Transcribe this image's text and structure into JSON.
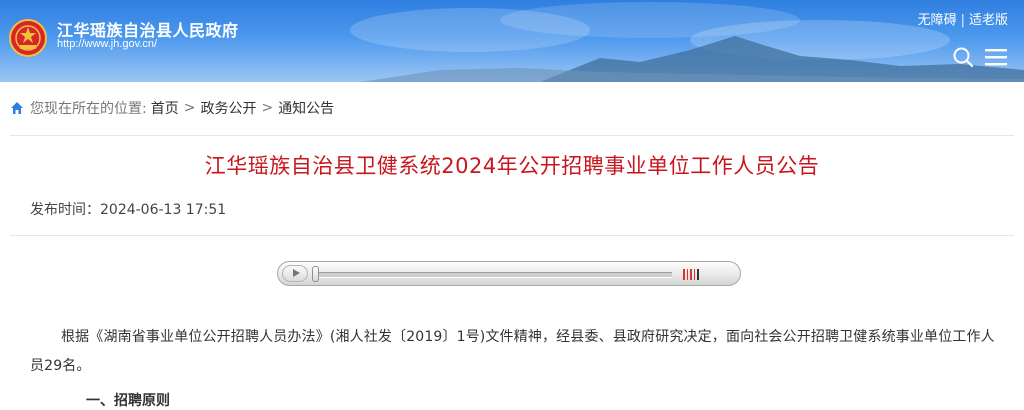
{
  "header": {
    "site_title": "江华瑶族自治县人民政府",
    "site_url": "http://www.jh.gov.cn/",
    "accessibility_link": "无障碍",
    "separator": "|",
    "elder_mode_link": "适老版",
    "icons": [
      "emblem-icon",
      "search-icon",
      "menu-icon"
    ]
  },
  "breadcrumb": {
    "prefix": "您现在所在的位置:",
    "items": [
      "首页",
      "政务公开",
      "通知公告"
    ],
    "separator": ">"
  },
  "article": {
    "title": "江华瑶族自治县卫健系统2024年公开招聘事业单位工作人员公告",
    "publish_label": "发布时间：",
    "publish_time": "2024-06-13 17:51",
    "paragraph1": "根据《湖南省事业单位公开招聘人员办法》(湘人社发〔2019〕1号)文件精神，经县委、县政府研究决定，面向社会公开招聘卫健系统事业单位工作人员29名。",
    "section_heading": "一、招聘原则"
  },
  "audio_player": {
    "progress": 0,
    "volume_level": 0.8
  },
  "colors": {
    "header_blue": "#2f7fe0",
    "title_red": "#c8161d",
    "text": "#333333"
  }
}
